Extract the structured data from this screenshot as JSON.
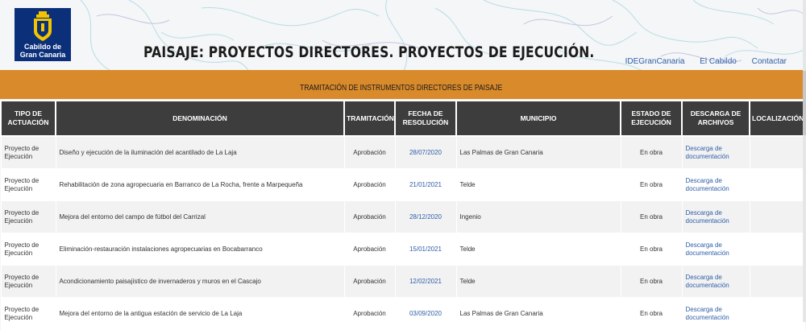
{
  "logo": {
    "line1": "Cabildo de",
    "line2": "Gran Canaria"
  },
  "page_title": "PAISAJE: PROYECTOS DIRECTORES. PROYECTOS DE EJECUCIÓN.",
  "nav_links": [
    "IDEGranCanaria",
    "El Cabildo",
    "Contactar"
  ],
  "band_title": "TRAMITACIÓN DE INSTRUMENTOS DIRECTORES DE PAISAJE",
  "columns": [
    "TIPO DE ACTUACIÓN",
    "DENOMINACIÓN",
    "TRAMITACIÓN",
    "FECHA DE RESOLUCIÓN",
    "MUNICIPIO",
    "ESTADO DE EJECUCIÓN",
    "DESCARGA DE ARCHIVOS",
    "LOCALIZACIÓN"
  ],
  "rows": [
    {
      "tipo": "Proyecto de Ejecución",
      "denominacion": "Diseño y ejecución de la iluminación del acantilado de La Laja",
      "tramitacion": "Aprobación",
      "fecha": "28/07/2020",
      "municipio": "Las Palmas de Gran Canaria",
      "estado": "En obra",
      "descarga": "Descarga de documentación",
      "localizacion": ""
    },
    {
      "tipo": "Proyecto de Ejecución",
      "denominacion": "Rehabilitación de zona agropecuaria en Barranco de La Rocha, frente a Marpequeña",
      "tramitacion": "Aprobación",
      "fecha": "21/01/2021",
      "municipio": "Telde",
      "estado": "En obra",
      "descarga": "Descarga de documentación",
      "localizacion": ""
    },
    {
      "tipo": "Proyecto de Ejecución",
      "denominacion": "Mejora del entorno del campo de fútbol del Carrizal",
      "tramitacion": "Aprobación",
      "fecha": "28/12/2020",
      "municipio": "Ingenio",
      "estado": "En obra",
      "descarga": "Descarga de documentación",
      "localizacion": ""
    },
    {
      "tipo": "Proyecto de Ejecución",
      "denominacion": "Eliminación-restauración instalaciones agropecuarias en Bocabarranco",
      "tramitacion": "Aprobación",
      "fecha": "15/01/2021",
      "municipio": "Telde",
      "estado": "En obra",
      "descarga": "Descarga de documentación",
      "localizacion": ""
    },
    {
      "tipo": "Proyecto de Ejecución",
      "denominacion": "Acondicionamiento paisajístico de invernaderos y muros en el Cascajo",
      "tramitacion": "Aprobación",
      "fecha": "12/02/2021",
      "municipio": "Telde",
      "estado": "En obra",
      "descarga": "Descarga de documentación",
      "localizacion": ""
    },
    {
      "tipo": "Proyecto de Ejecución",
      "denominacion": "Mejora del entorno de la antigua estación de servicio de La Laja",
      "tramitacion": "Aprobación",
      "fecha": "03/09/2020",
      "municipio": "Las Palmas de Gran Canaria",
      "estado": "En obra",
      "descarga": "Descarga de documentación",
      "localizacion": ""
    }
  ]
}
